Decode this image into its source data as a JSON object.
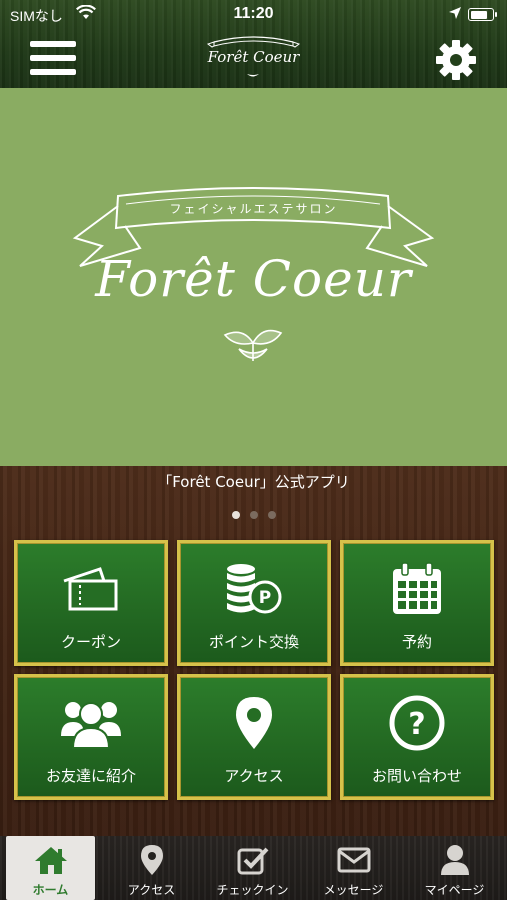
{
  "status_bar": {
    "carrier": "SIMなし",
    "time": "11:20",
    "battery_level": 0.8
  },
  "header": {
    "logo_text": "Forêt Coeur",
    "menu_icon": "hamburger-menu-icon",
    "settings_icon": "gear-icon"
  },
  "hero": {
    "subtitle": "フェイシャルエステサロン",
    "brand": "Forêt Coeur",
    "background_color": "#8aac62"
  },
  "carousel": {
    "caption": "「Forêt Coeur」公式アプリ",
    "slide_count": 3,
    "active_index": 0
  },
  "menu_tiles": [
    {
      "label": "クーポン",
      "icon": "ticket-icon"
    },
    {
      "label": "ポイント交換",
      "icon": "coins-point-icon"
    },
    {
      "label": "予約",
      "icon": "calendar-icon"
    },
    {
      "label": "お友達に紹介",
      "icon": "users-group-icon"
    },
    {
      "label": "アクセス",
      "icon": "map-pin-icon"
    },
    {
      "label": "お問い合わせ",
      "icon": "question-circle-icon"
    }
  ],
  "tab_bar": {
    "tabs": [
      {
        "label": "ホーム",
        "icon": "home-icon",
        "active": true
      },
      {
        "label": "アクセス",
        "icon": "map-pin-icon",
        "active": false
      },
      {
        "label": "チェックイン",
        "icon": "checkbox-icon",
        "active": false
      },
      {
        "label": "メッセージ",
        "icon": "envelope-icon",
        "active": false
      },
      {
        "label": "マイページ",
        "icon": "person-icon",
        "active": false
      }
    ]
  },
  "colors": {
    "header_green": "#1f3817",
    "tile_green": "#256d24",
    "tile_border": "#d6c24a",
    "wood": "#412414",
    "active_tab_text": "#2f7b2e"
  }
}
